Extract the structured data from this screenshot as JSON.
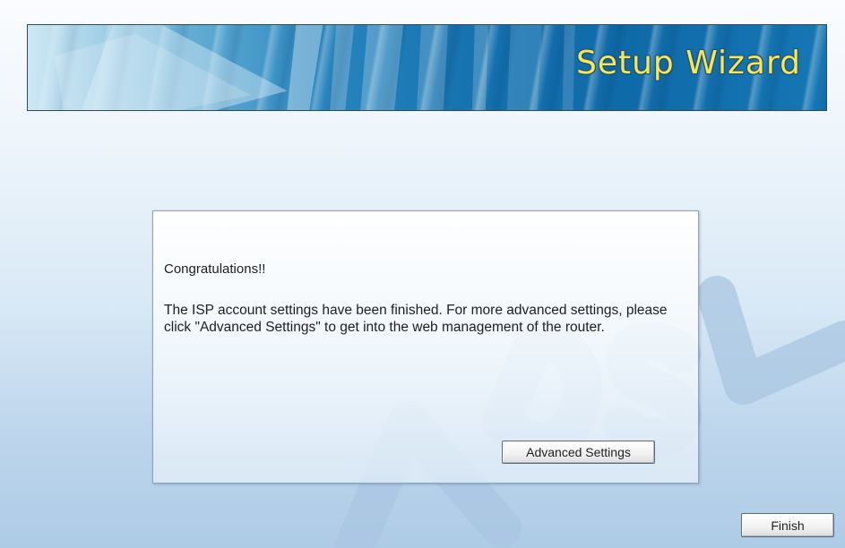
{
  "banner": {
    "title": "Setup Wizard",
    "title_color": "#f4e75a",
    "background_color": "#1673b0"
  },
  "watermark": {
    "text": "ADSL"
  },
  "dialog": {
    "heading": "Congratulations!!",
    "message": "The ISP account settings have been finished. For more advanced settings, please click \"Advanced Settings\" to get into the web management of the router.",
    "advanced_button_label": "Advanced Settings"
  },
  "footer": {
    "finish_button_label": "Finish"
  },
  "colors": {
    "page_background_top": "#fafcfe",
    "page_background_bottom": "#aecbe6",
    "text": "#1e1e1e"
  }
}
